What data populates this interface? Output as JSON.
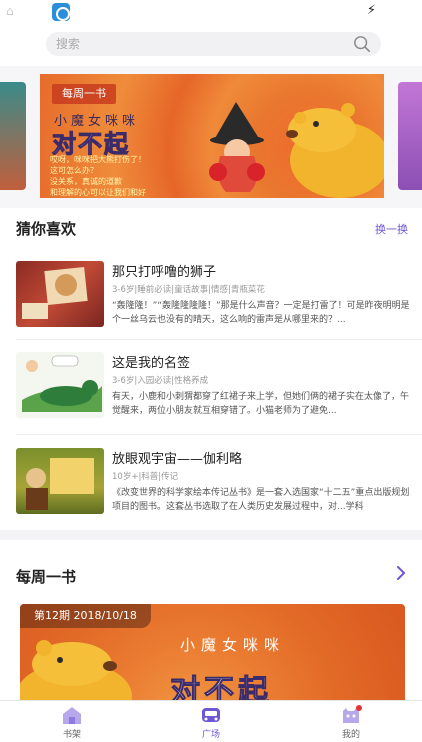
{
  "search": {
    "placeholder": "搜索"
  },
  "banner": {
    "tag": "每周一书",
    "subtitle": "小魔女咪咪",
    "title": "对不起",
    "lines": [
      "哎呀，咪咪把大熊打伤了！",
      "这可怎么办？",
      "没关系，真诚的道歉",
      "和理解的心可以让我们和好"
    ]
  },
  "recommend": {
    "title": "猜你喜欢",
    "refresh": "换一换",
    "items": [
      {
        "title": "那只打呼噜的狮子",
        "meta": "3-6岁|睡前必读|童话故事|情感|青瓶菜花",
        "desc": "“轰隆隆！”“轰隆隆隆隆！”那是什么声音？一定是打雷了！可是昨夜明明是个一丝乌云也没有的晴天，这么响的雷声是从哪里来的？..."
      },
      {
        "title": "这是我的名签",
        "meta": "3-6岁|入园必读|性格养成",
        "desc": "有天，小鹿和小刺猬都穿了红裙子来上学，但她们俩的裙子实在太像了，午觉醒来，两位小朋友就互相穿错了。小猫老师为了避免..."
      },
      {
        "title": "放眼观宇宙——伽利略",
        "meta": "10岁+|科普|传记",
        "desc": "《改变世界的科学家绘本传记丛书》是一套入选国家“十二五”重点出版规划项目的图书。这套丛书选取了在人类历史发展过程中，对...学科"
      }
    ]
  },
  "weekly": {
    "title": "每周一书",
    "issue": "第12期 2018/10/18",
    "subtitle": "小魔女咪咪",
    "book_title": "对不起"
  },
  "tabs": [
    {
      "label": "书架",
      "icon": "bookshelf-icon"
    },
    {
      "label": "广场",
      "icon": "plaza-icon"
    },
    {
      "label": "我的",
      "icon": "profile-icon"
    }
  ],
  "colors": {
    "accent": "#6f56d6",
    "banner_orange": "#e9772e"
  }
}
